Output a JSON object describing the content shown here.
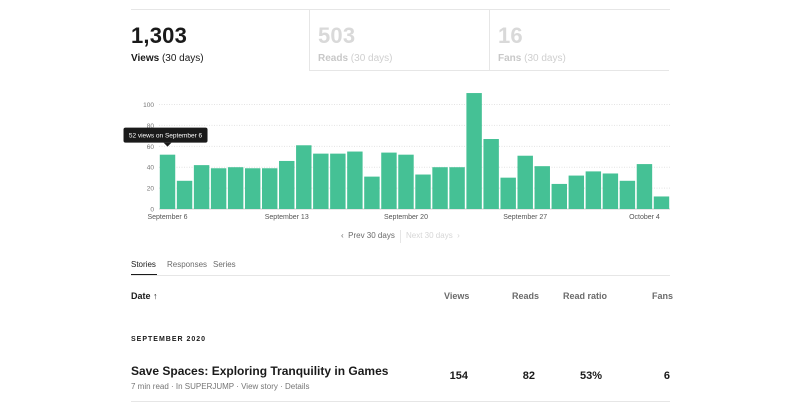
{
  "stats": [
    {
      "value": "1,303",
      "label": "Views",
      "period": "(30 days)"
    },
    {
      "value": "503",
      "label": "Reads",
      "period": "(30 days)"
    },
    {
      "value": "16",
      "label": "Fans",
      "period": "(30 days)"
    }
  ],
  "chart_data": {
    "type": "bar",
    "y_ticks": [
      0,
      20,
      40,
      60,
      80,
      100
    ],
    "ylim": [
      0,
      112
    ],
    "x_tick_labels": [
      "September 6",
      "September 13",
      "September 20",
      "September 27",
      "October 4"
    ],
    "categories": [
      "Sep 6",
      "Sep 7",
      "Sep 8",
      "Sep 9",
      "Sep 10",
      "Sep 11",
      "Sep 12",
      "Sep 13",
      "Sep 14",
      "Sep 15",
      "Sep 16",
      "Sep 17",
      "Sep 18",
      "Sep 19",
      "Sep 20",
      "Sep 21",
      "Sep 22",
      "Sep 23",
      "Sep 24",
      "Sep 25",
      "Sep 26",
      "Sep 27",
      "Sep 28",
      "Sep 29",
      "Sep 30",
      "Oct 1",
      "Oct 2",
      "Oct 3",
      "Oct 4",
      "Oct 5"
    ],
    "values": [
      52,
      27,
      42,
      39,
      40,
      39,
      39,
      46,
      61,
      53,
      53,
      55,
      31,
      54,
      52,
      33,
      40,
      40,
      111,
      67,
      30,
      51,
      41,
      24,
      32,
      36,
      34,
      27,
      43,
      12
    ],
    "bar_color": "#45c195",
    "grid": true,
    "tooltip": "52 views on September 6"
  },
  "pager": {
    "prev": "Prev 30 days",
    "next": "Next 30 days"
  },
  "tabs": [
    {
      "label": "Stories",
      "active": true
    },
    {
      "label": "Responses",
      "active": false
    },
    {
      "label": "Series",
      "active": false
    }
  ],
  "table": {
    "headers": {
      "date": "Date",
      "views": "Views",
      "reads": "Reads",
      "read_ratio": "Read ratio",
      "fans": "Fans"
    },
    "section": "SEPTEMBER 2020",
    "rows": [
      {
        "title": "Save Spaces: Exploring Tranquility in Games",
        "read_time": "7 min read",
        "publication": "In SUPERJUMP",
        "view_story": "View story",
        "details": "Details",
        "views": "154",
        "reads": "82",
        "read_ratio": "53%",
        "fans": "6"
      }
    ]
  }
}
